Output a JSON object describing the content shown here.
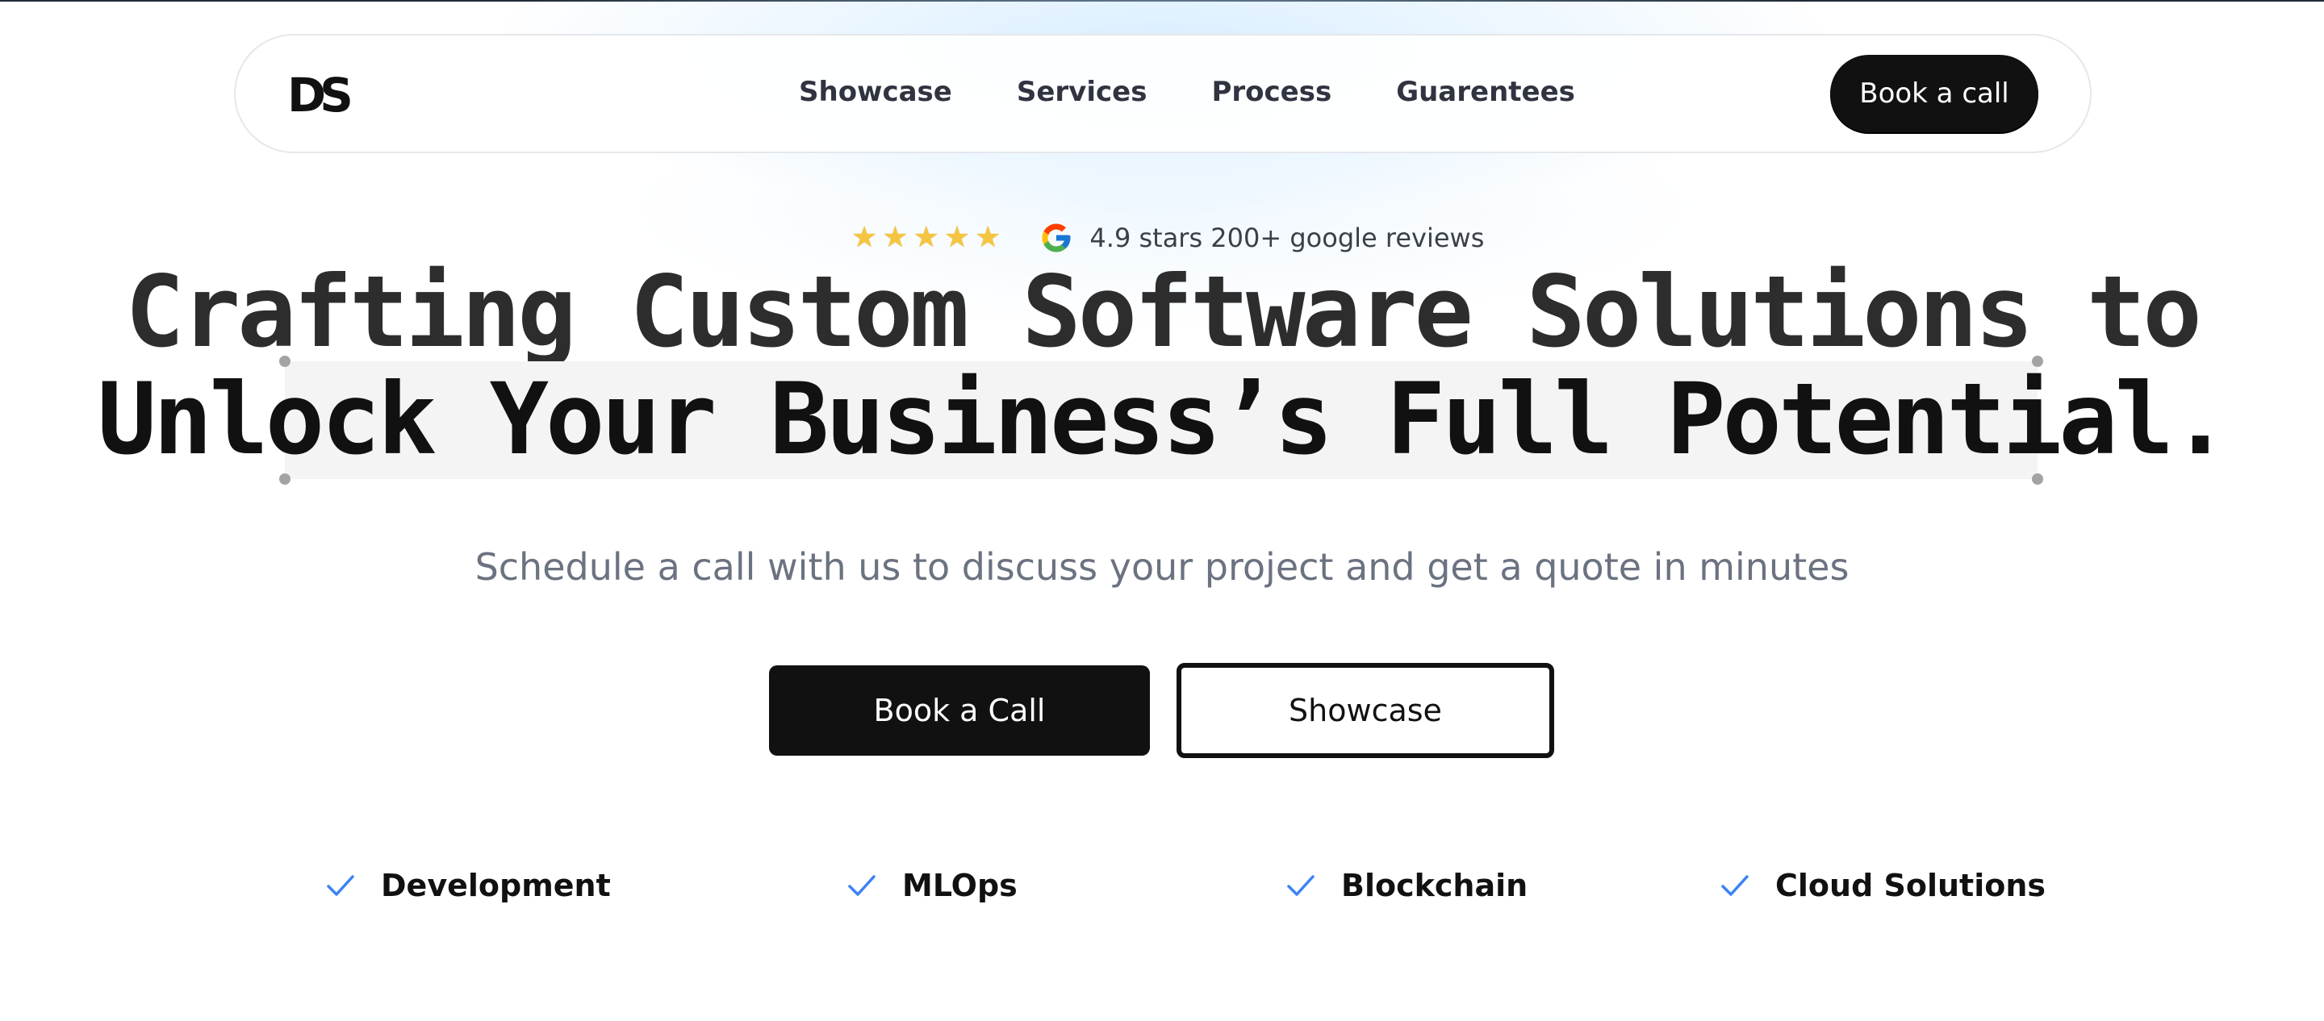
{
  "nav": {
    "logo": "DS",
    "links": [
      "Showcase",
      "Services",
      "Process",
      "Guarentees"
    ],
    "cta": "Book a call"
  },
  "reviews": {
    "stars": "★★★★★",
    "rating": 4.9,
    "text": "4.9 stars 200+ google reviews"
  },
  "hero": {
    "headline_line1": "Crafting Custom Software Solutions to",
    "headline_line2": "Unlock Your Business’s Full Potential.",
    "subtitle": "Schedule a call with us to discuss your project and get a quote in minutes",
    "primary_button": "Book a Call",
    "secondary_button": "Showcase"
  },
  "features": [
    "Development",
    "MLOps",
    "Blockchain",
    "Cloud Solutions"
  ],
  "colors": {
    "primary": "#111111",
    "accent_check": "#3b82f6",
    "star": "#f5c542",
    "muted_text": "#6b7280"
  }
}
